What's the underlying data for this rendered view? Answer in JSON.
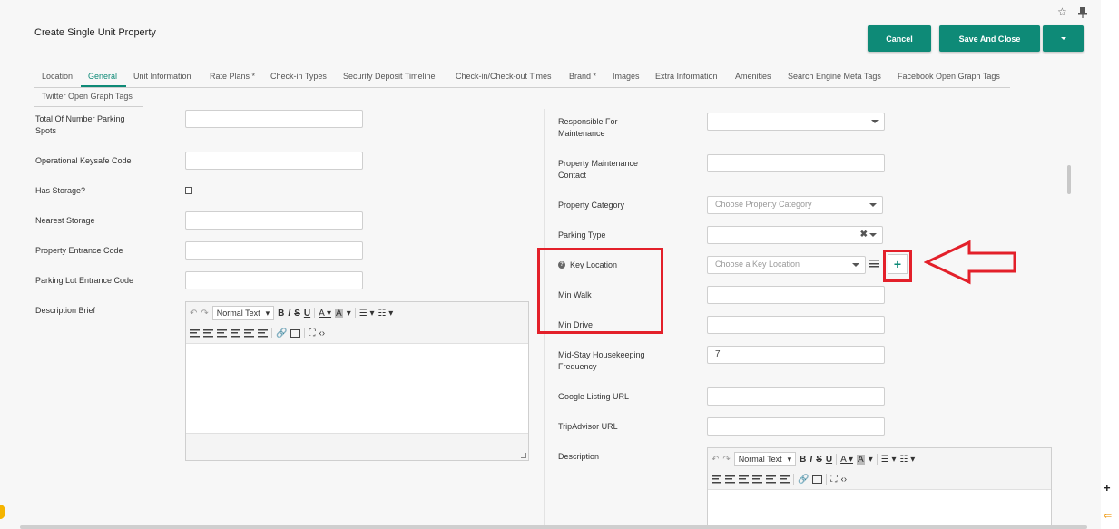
{
  "header": {
    "title": "Create Single Unit Property",
    "cancel_label": "Cancel",
    "save_close_label": "Save And Close"
  },
  "tabs": [
    {
      "label": "Location"
    },
    {
      "label": "General"
    },
    {
      "label": "Unit Information"
    },
    {
      "label": "Rate Plans *"
    },
    {
      "label": "Check-in Types"
    },
    {
      "label": "Security Deposit Timeline"
    },
    {
      "label": "Check-in/Check-out Times"
    },
    {
      "label": "Brand *"
    },
    {
      "label": "Images"
    },
    {
      "label": "Extra Information"
    },
    {
      "label": "Amenities"
    },
    {
      "label": "Search Engine Meta Tags"
    },
    {
      "label": "Facebook Open Graph Tags"
    },
    {
      "label": "Twitter Open Graph Tags"
    }
  ],
  "active_tab": "General",
  "left_form": {
    "parking_spots_label": "Total Of Number Parking Spots",
    "keysafe_label": "Operational Keysafe Code",
    "has_storage_label": "Has Storage?",
    "nearest_storage_label": "Nearest Storage",
    "entrance_code_label": "Property Entrance Code",
    "parking_code_label": "Parking Lot Entrance Code",
    "description_brief_label": "Description Brief"
  },
  "right_form": {
    "responsible_label": "Responsible For Maintenance",
    "maintenance_contact_label": "Property Maintenance Contact",
    "category_label": "Property Category",
    "category_placeholder": "Choose Property Category",
    "parking_type_label": "Parking Type",
    "key_location_label": "Key Location",
    "key_location_placeholder": "Choose a Key Location",
    "min_walk_label": "Min Walk",
    "min_drive_label": "Min Drive",
    "housekeeping_label": "Mid-Stay Housekeeping Frequency",
    "housekeeping_value": "7",
    "google_label": "Google Listing URL",
    "tripadvisor_label": "TripAdvisor URL",
    "description_label": "Description"
  },
  "editor": {
    "format_label": "Normal Text"
  },
  "colors": {
    "accent": "#0e8a77",
    "highlight": "#e3202a"
  }
}
